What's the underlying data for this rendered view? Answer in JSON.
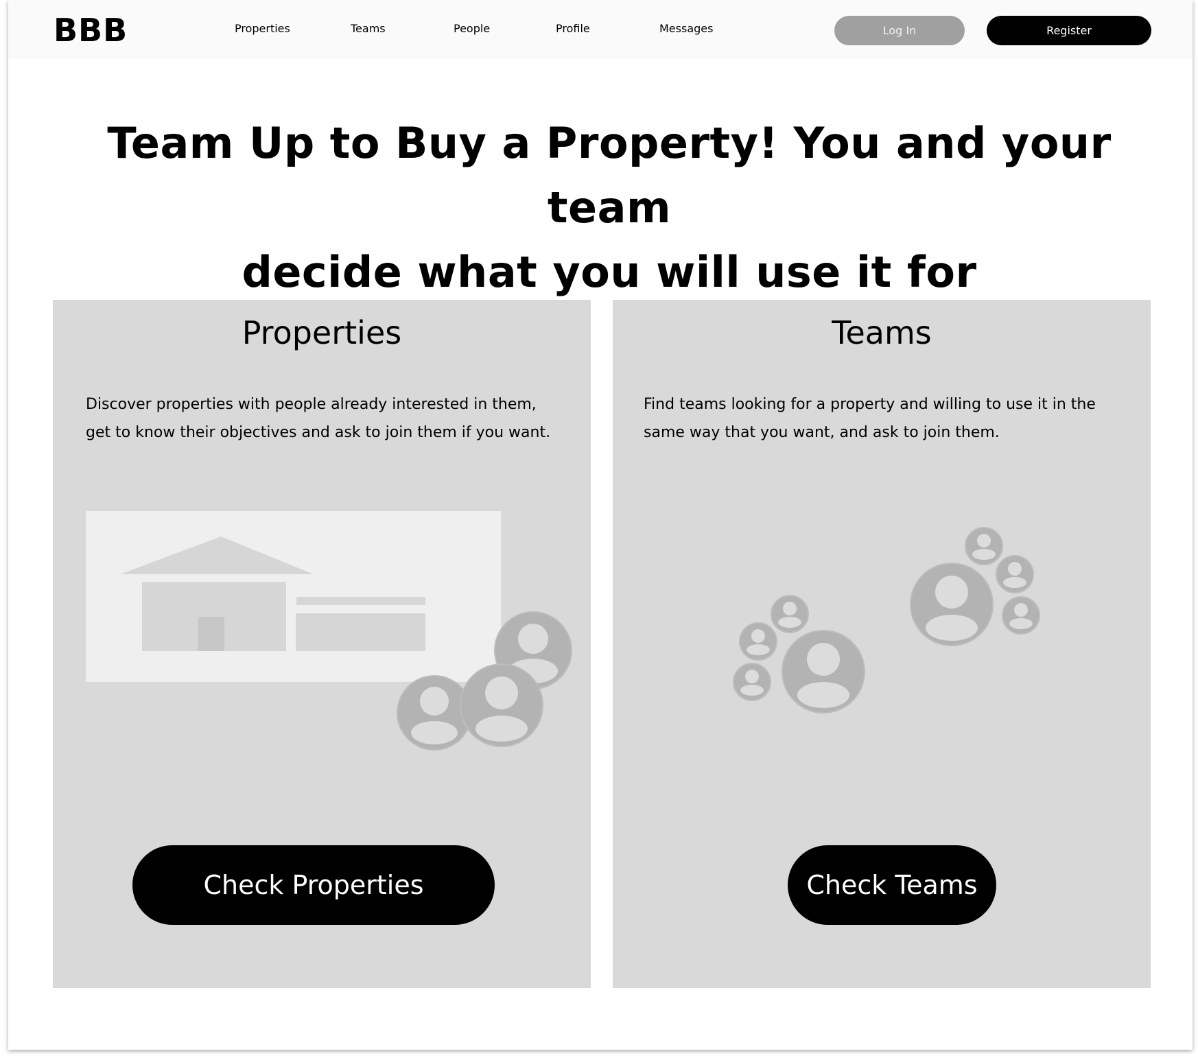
{
  "header": {
    "logo": "BBB",
    "nav": [
      "Properties",
      "Teams",
      "People",
      "Profile",
      "Messages"
    ],
    "login_label": "Log In",
    "register_label": "Register"
  },
  "hero": {
    "line1": "Team Up to Buy a Property! You and your team",
    "line2": "decide what you will use it for"
  },
  "cards": [
    {
      "title": "Properties",
      "description_line1": "Discover properties with people already interested in them,",
      "description_line2": "get to know their objectives and ask to join them if you want.",
      "button_label": "Check Properties",
      "illustration": "house-with-people-icon"
    },
    {
      "title": "Teams",
      "description_line1": "Find teams looking for a property and willing to use it in the",
      "description_line2": "same way that you want, and ask to join them.",
      "button_label": "Check Teams",
      "illustration": "people-groups-icon"
    }
  ],
  "colors": {
    "header_bg": "#fafafa",
    "card_bg": "#d9d9d9",
    "login_button": "#a0a0a0",
    "primary_button": "#000000",
    "placeholder_light": "#efefef",
    "placeholder_mid": "#d0d0d0",
    "avatar": "#b3b3b3"
  }
}
